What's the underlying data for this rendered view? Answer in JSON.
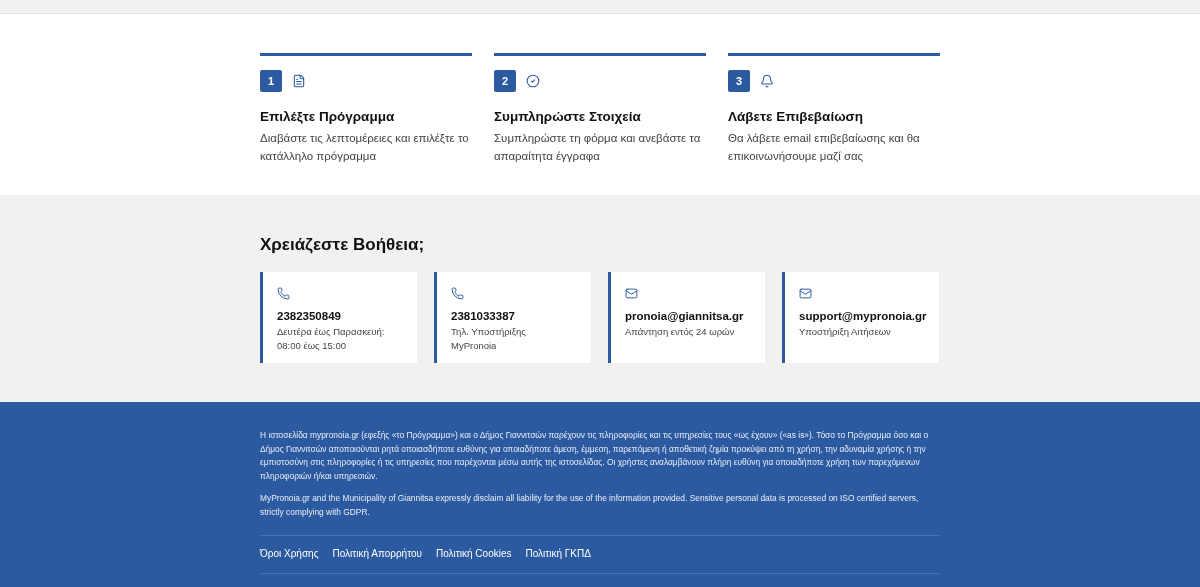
{
  "steps": [
    {
      "number": "1",
      "kind": "document",
      "title": "Επιλέξτε Πρόγραμμα",
      "text": "Διαβάστε τις λεπτομέρειες και επιλέξτε το κατάλληλο πρόγραμμα"
    },
    {
      "number": "2",
      "kind": "check",
      "title": "Συμπληρώστε Στοιχεία",
      "text": "Συμπληρώστε τη φόρμα και ανεβάστε τα απαραίτητα έγγραφα"
    },
    {
      "number": "3",
      "kind": "bell",
      "title": "Λάβετε Επιβεβαίωση",
      "text": "Θα λάβετε email επιβεβαίωσης και θα επικοινωνήσουμε μαζί σας"
    }
  ],
  "help": {
    "heading": "Χρειάζεστε Βοήθεια;",
    "contacts": [
      {
        "kind": "phone",
        "value": "2382350849",
        "lines": [
          "Δευτέρα έως Παρασκευή:",
          "08:00 έως 15:00"
        ]
      },
      {
        "kind": "phone",
        "value": "2381033387",
        "lines": [
          "Τηλ. Υποστήριξης",
          "MyPronoia"
        ]
      },
      {
        "kind": "email",
        "value": "pronoia@giannitsa.gr",
        "lines": [
          "Απάντηση εντός 24 ωρών"
        ]
      },
      {
        "kind": "email",
        "value": "support@mypronoia.gr",
        "lines": [
          "Υποστήριξη Αιτήσεων"
        ]
      }
    ]
  },
  "footer": {
    "disclaimers": [
      "Η ιστοσελίδα mypronoia.gr (εφεξής «το Πρόγραμμα») και ο Δήμος Γιαννιτσών παρέχουν τις πληροφορίες και τις υπηρεσίες τους «ως έχουν» («as is»). Τόσο το Πρόγραμμα όσο και ο Δήμος Γιαννιτσών αποποιούνται ρητά οποιασδήποτε ευθύνης για οποιαδήποτε άμεση, έμμεση, παρεπόμενη ή αποθετική ζημία προκύψει από τη χρήση, την αδυναμία χρήσης ή την εμπιστοσύνη στις πληροφορίες ή τις υπηρεσίες που παρέχονται μέσω αυτής της ιστοσελίδας. Οι χρήστες αναλαμβάνουν πλήρη ευθύνη για οποιαδήποτε χρήση των παρεχόμενων πληροφοριών ή/και υπηρεσιών.",
      "MyPronoia.gr and the Municipality of Giannitsa expressly disclaim all liability for the use of the information provided. Sensitive personal data is processed on ISO certified servers, strictly complying with GDPR."
    ],
    "links": [
      "Όροι Χρήσης",
      "Πολιτική Απορρήτου",
      "Πολιτική Cookies",
      "Πολιτική ΓΚΠΔ"
    ]
  }
}
